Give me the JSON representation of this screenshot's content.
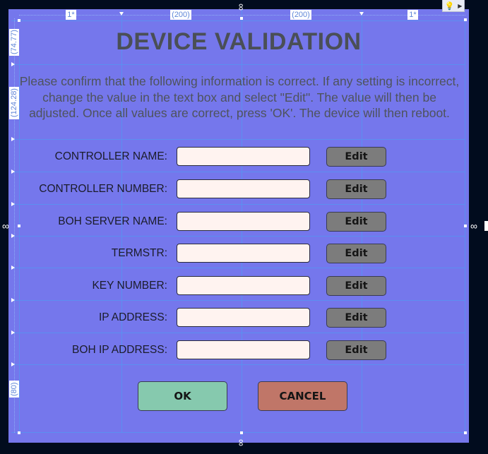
{
  "designer": {
    "column_markers": [
      "1*",
      "(200)",
      "(200)",
      "1*"
    ],
    "row_markers": [
      "(74.77)",
      "(124.28)",
      "(80)"
    ],
    "lightbulb_icon": "lightbulb-icon",
    "expand_icon": "triangle-right-icon",
    "link_icon": "chain-link-icon"
  },
  "dialog": {
    "title": "DEVICE VALIDATION",
    "description": "Please confirm that the following information is correct. If any setting is incorrect, change the value in the text box and select \"Edit\". The value will then be adjusted. Once all values are correct, press 'OK'. The device will then reboot.",
    "fields": [
      {
        "label": "CONTROLLER NAME:",
        "value": "",
        "button": "Edit"
      },
      {
        "label": "CONTROLLER NUMBER:",
        "value": "",
        "button": "Edit"
      },
      {
        "label": "BOH SERVER NAME:",
        "value": "",
        "button": "Edit"
      },
      {
        "label": "TERMSTR:",
        "value": "",
        "button": "Edit"
      },
      {
        "label": "KEY NUMBER:",
        "value": "",
        "button": "Edit"
      },
      {
        "label": "IP ADDRESS:",
        "value": "",
        "button": "Edit"
      },
      {
        "label": "BOH IP ADDRESS:",
        "value": "",
        "button": "Edit"
      }
    ],
    "ok_label": "OK",
    "cancel_label": "CANCEL"
  },
  "colors": {
    "canvas": "#7577ec",
    "ok": "#86c9ae",
    "cancel": "#c07668",
    "edit": "#7c7c7c",
    "input": "#fff3f0",
    "title_text": "#4a4f56"
  }
}
